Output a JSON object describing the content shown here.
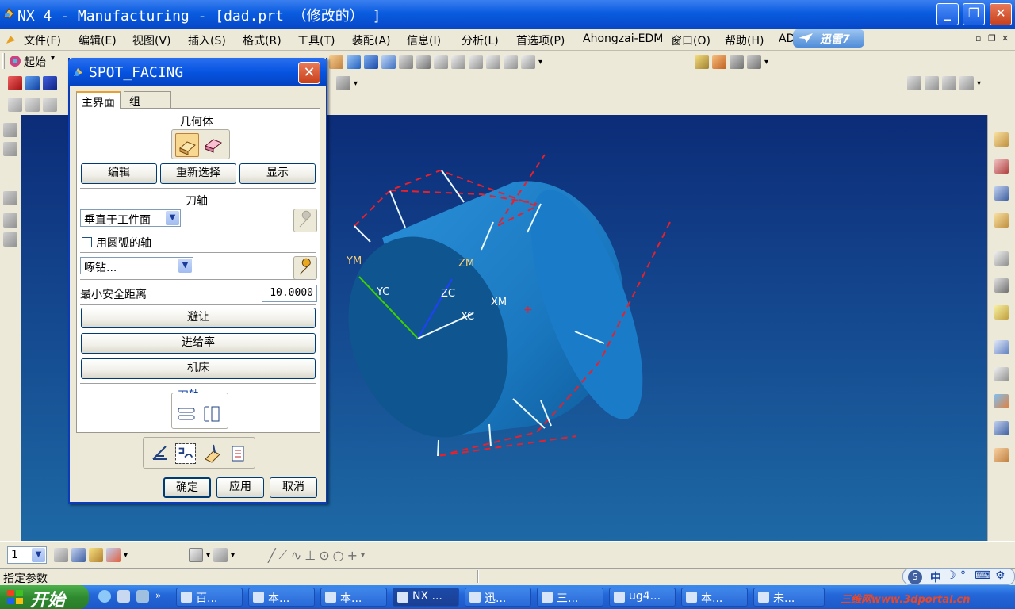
{
  "window": {
    "title": "NX 4 - Manufacturing - [dad.prt （修改的） ]"
  },
  "window_buttons": {
    "minimize": "_",
    "maximize": "❐",
    "close": "✕"
  },
  "menu": [
    "文件(F)",
    "编辑(E)",
    "视图(V)",
    "插入(S)",
    "格式(R)",
    "工具(T)",
    "装配(A)",
    "信息(I)",
    "分析(L)",
    "首选项(P)",
    "Ahongzai-EDM",
    "窗口(O)",
    "帮助(H)",
    "AD"
  ],
  "xunlei": {
    "label": "迅雷7"
  },
  "toolbar": {
    "start_label": "起始"
  },
  "dialog": {
    "title": "SPOT_FACING",
    "close": "✕",
    "tabs": [
      "主界面",
      "组"
    ],
    "geometry_label": "几何体",
    "geometry_buttons": [
      "编辑",
      "重新选择",
      "显示"
    ],
    "tool_axis_label": "刀轴",
    "tool_axis_value": "垂直于工件面",
    "use_arc_axis_label": "用圆弧的轴",
    "cycle_value": "啄钻...",
    "min_clearance_label": "最小安全距离",
    "min_clearance_value": "10.0000",
    "avoid_button": "避让",
    "feed_button": "进给率",
    "machine_button": "机床",
    "toolpath_label": "刀轨",
    "ok": "确定",
    "apply": "应用",
    "cancel": "取消"
  },
  "viewport_labels": {
    "ym": "YM",
    "yc": "YC",
    "zm": "ZM",
    "zc": "ZC",
    "xm": "XM",
    "xc": "XC"
  },
  "bottom": {
    "layer_value": "1"
  },
  "status": {
    "message": "指定参数"
  },
  "ime": {
    "text": "中"
  },
  "taskbar": {
    "start": "开始",
    "items": [
      "百...",
      "本...",
      "本...",
      "NX ...",
      "迅...",
      "三...",
      "ug4...",
      "本...",
      "未..."
    ]
  },
  "watermark": "三维网www.3dportal.cn",
  "colors": {
    "titlebar": "#0a5ce0",
    "viewport_top": "#0c2c78",
    "cylinder": "#1a7cc8",
    "toolpath": "#e8202c",
    "taskbar": "#2466d8",
    "start": "#2f8a2f"
  }
}
